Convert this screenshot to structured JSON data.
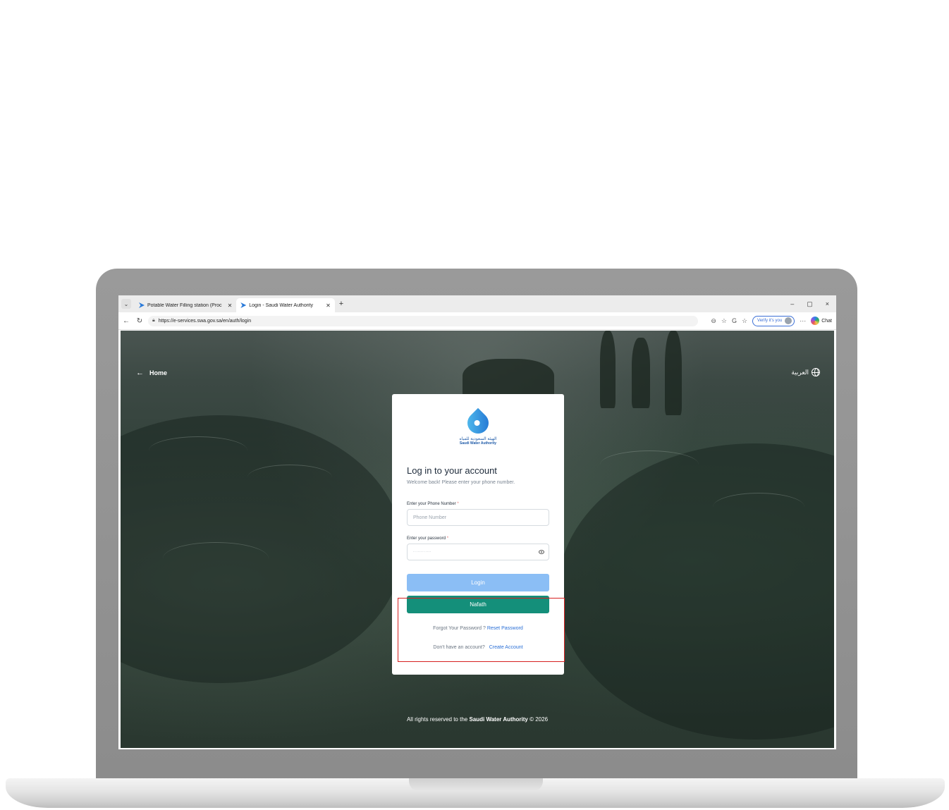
{
  "browser": {
    "tabs": [
      {
        "title": "Potable Water Filling station (Proc",
        "active": false
      },
      {
        "title": "Login - Saudi Water Authority",
        "active": true
      }
    ],
    "new_tab_symbol": "+",
    "window_controls": [
      "–",
      "▢",
      "×"
    ],
    "url": "https://e-services.swa.gov.sa/en/auth/login",
    "verify_label": "Verify it's you",
    "chat_label": "Chat",
    "more_symbol": "···"
  },
  "page": {
    "home_label": "Home",
    "language_label": "العربية",
    "logo": {
      "arabic": "الهيئة السعودية للمياه",
      "english": "Saudi Water Authority"
    },
    "title": "Log in to your account",
    "subtitle": "Welcome back! Please enter your phone number.",
    "phone": {
      "label": "Enter your Phone Number",
      "required": "*",
      "placeholder": "Phone Number"
    },
    "password": {
      "label": "Enter your password",
      "required": "*",
      "masked_value": "············"
    },
    "login_button": "Login",
    "nafath_button": "Nafath",
    "forgot_text": "Forgot Your Password ?",
    "reset_link": "Reset Password",
    "no_account_text": "Don't have an account?",
    "create_account_link": "Create Account",
    "footer_prefix": "All rights reserved to the",
    "footer_org": "Saudi Water Authority",
    "footer_suffix": "© 2026"
  },
  "colors": {
    "login_button": "#8bbef5",
    "nafath_button": "#148f7a",
    "highlight": "#d62020",
    "link": "#2a6fd6"
  }
}
